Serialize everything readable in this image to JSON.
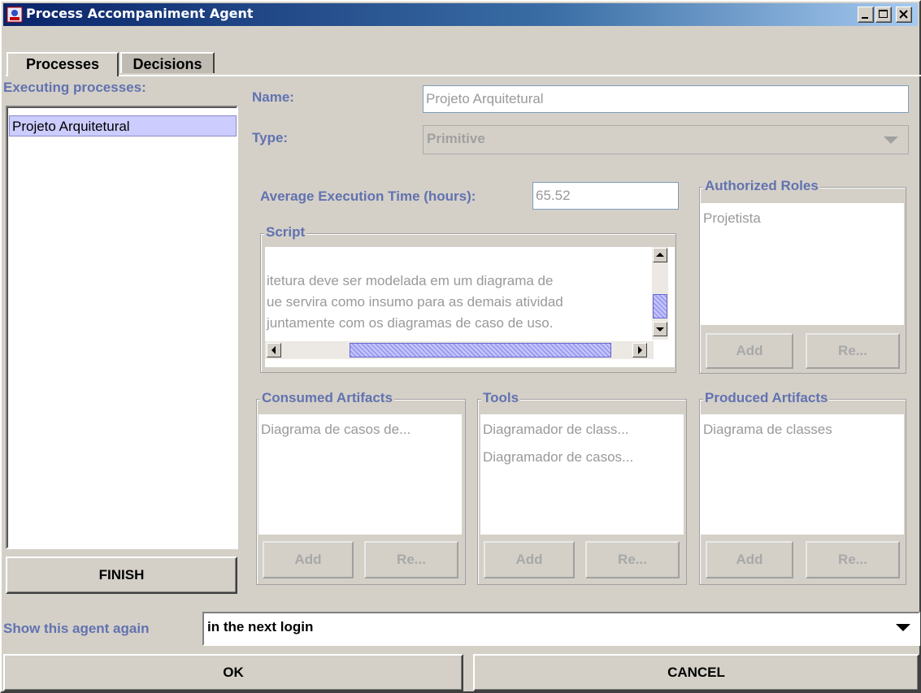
{
  "window": {
    "title": "Process Accompaniment Agent"
  },
  "tabs": [
    {
      "label": "Processes",
      "active": true
    },
    {
      "label": "Decisions",
      "active": false
    }
  ],
  "left": {
    "heading": "Executing processes:",
    "processes": [
      "Projeto Arquitetural"
    ],
    "finish_label": "FINISH"
  },
  "details": {
    "name_label": "Name:",
    "name_value": "Projeto Arquitetural",
    "type_label": "Type:",
    "type_value": "Primitive",
    "avg_time_label": "Average Execution Time (hours):",
    "avg_time_value": "65.52",
    "script_title": "Script",
    "script_lines": [
      "itetura deve ser modelada em um diagrama de",
      "ue servira como insumo para as demais atividad",
      " juntamente com os diagramas de caso de uso."
    ],
    "authorized_roles_title": "Authorized Roles",
    "authorized_roles": [
      "Projetista"
    ],
    "consumed_title": "Consumed Artifacts",
    "consumed": [
      "Diagrama de casos de..."
    ],
    "tools_title": "Tools",
    "tools": [
      "Diagramador de class...",
      "Diagramador de casos..."
    ],
    "produced_title": "Produced Artifacts",
    "produced": [
      "Diagrama de classes"
    ],
    "add_label": "Add",
    "remove_label": "Re..."
  },
  "footer": {
    "show_again_label": "Show this agent again",
    "show_again_value": "in the next login",
    "ok_label": "OK",
    "cancel_label": "CANCEL"
  },
  "colors": {
    "label_blue": "#6272b0",
    "selection": "#ccccff",
    "titlebar": "#0a246a"
  }
}
